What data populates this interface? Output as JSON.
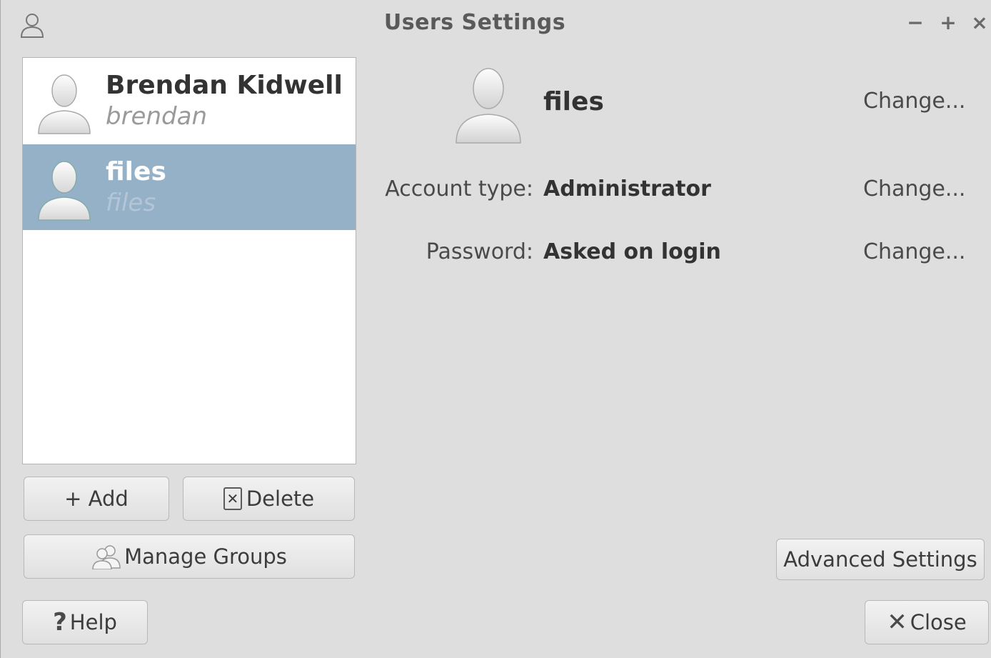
{
  "window": {
    "title": "Users Settings",
    "controls": {
      "minimize": "−",
      "maximize": "+",
      "close": "×"
    }
  },
  "users": [
    {
      "full_name": "Brendan Kidwell",
      "username": "brendan",
      "selected": false
    },
    {
      "full_name": "files",
      "username": "files",
      "selected": true
    }
  ],
  "buttons": {
    "add": "+ Add",
    "delete": "Delete",
    "manage_groups": "Manage Groups",
    "help": "Help",
    "advanced_settings": "Advanced Settings",
    "close": "Close"
  },
  "detail": {
    "name": "files",
    "change_label": "Change...",
    "account_type_label": "Account type:",
    "account_type_value": "Administrator",
    "password_label": "Password:",
    "password_value": "Asked on login"
  },
  "colors": {
    "selection": "#94b1c8",
    "window_bg": "#dedede"
  }
}
